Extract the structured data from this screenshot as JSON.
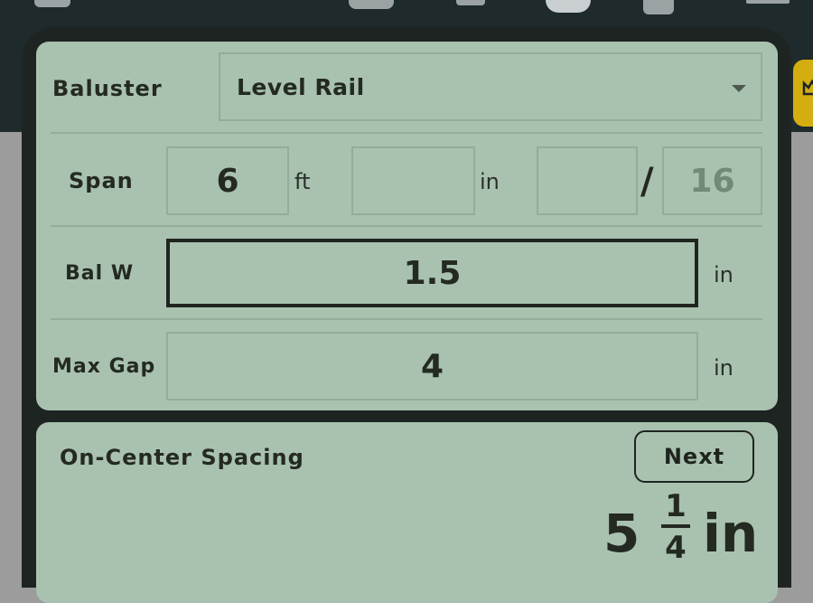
{
  "form": {
    "baluster": {
      "label": "Baluster",
      "value": "Level Rail"
    },
    "span": {
      "label": "Span",
      "feet_value": "6",
      "feet_unit": "ft",
      "inches_value": "",
      "inches_unit": "in",
      "fraction_numerator": "",
      "fraction_separator": "/",
      "fraction_denominator_placeholder": "16"
    },
    "baluster_width": {
      "label": "Bal W",
      "value": "1.5",
      "unit": "in"
    },
    "max_gap": {
      "label": "Max Gap",
      "value": "4",
      "unit": "in"
    }
  },
  "result": {
    "title": "On-Center Spacing",
    "next_label": "Next",
    "whole": "5",
    "numerator": "1",
    "denominator": "4",
    "unit": "in"
  },
  "colors": {
    "panel": "#a9c2af",
    "frame": "#1e2422",
    "topbar": "#1e2a2c",
    "accent_badge": "#d4ae10"
  }
}
